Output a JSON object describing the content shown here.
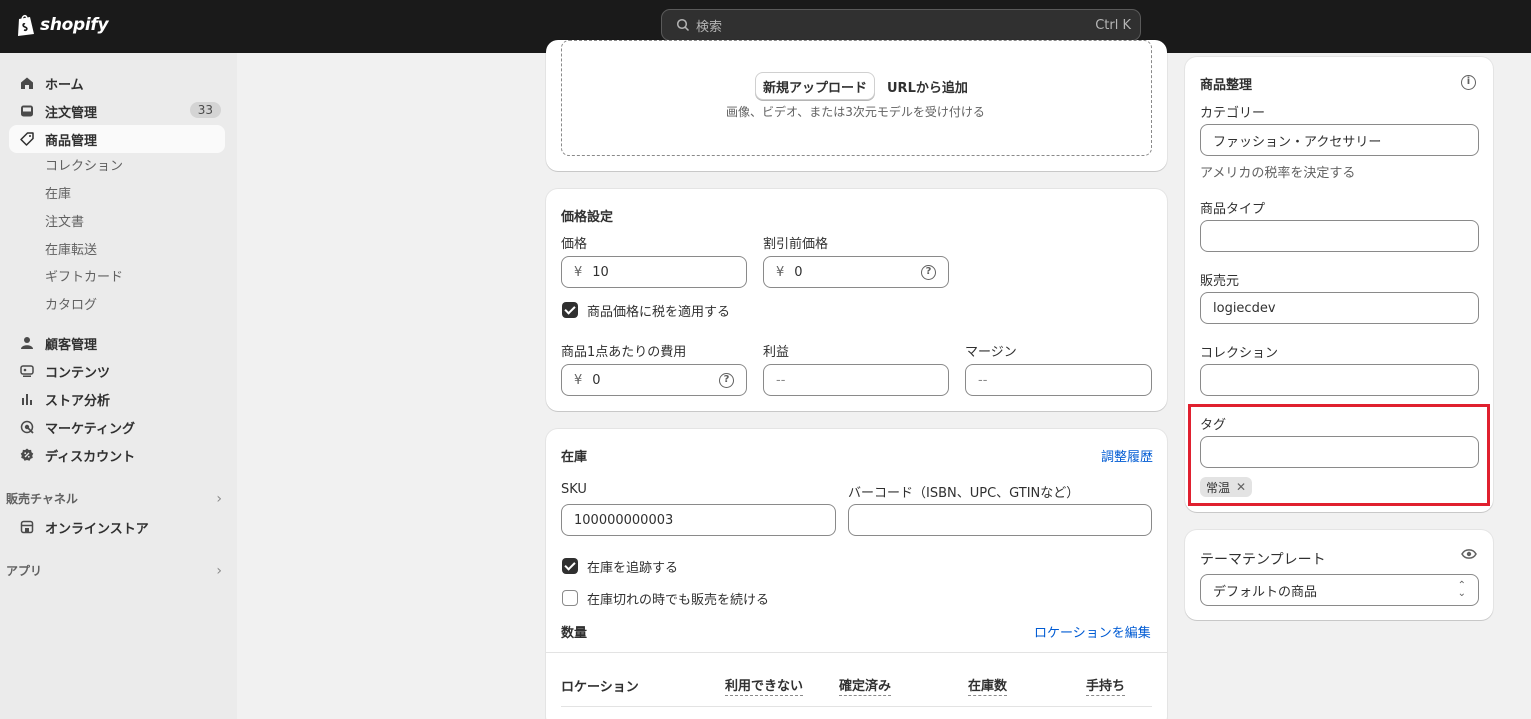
{
  "app": {
    "brand": "shopify"
  },
  "search": {
    "placeholder": "検索",
    "shortcut": "Ctrl K"
  },
  "sidebar": {
    "items": [
      {
        "label": "ホーム",
        "icon": "home-icon"
      },
      {
        "label": "注文管理",
        "icon": "inbox-icon",
        "badge": "33"
      },
      {
        "label": "商品管理",
        "icon": "tag-icon"
      }
    ],
    "product_sub": [
      "コレクション",
      "在庫",
      "注文書",
      "在庫転送",
      "ギフトカード",
      "カタログ"
    ],
    "items2": [
      {
        "label": "顧客管理",
        "icon": "person-icon"
      },
      {
        "label": "コンテンツ",
        "icon": "content-icon"
      },
      {
        "label": "ストア分析",
        "icon": "chart-icon"
      },
      {
        "label": "マーケティング",
        "icon": "target-icon"
      },
      {
        "label": "ディスカウント",
        "icon": "discount-icon"
      }
    ],
    "sales_channels": "販売チャネル",
    "online_store": "オンラインストア",
    "apps": "アプリ"
  },
  "media": {
    "upload_button": "新規アップロード",
    "add_from_url": "URLから追加",
    "hint": "画像、ビデオ、または3次元モデルを受け付ける"
  },
  "pricing": {
    "title": "価格設定",
    "price_label": "価格",
    "price_value": "10",
    "compare_label": "割引前価格",
    "compare_value": "0",
    "currency": "¥",
    "tax_label": "商品価格に税を適用する",
    "cost_label": "商品1点あたりの費用",
    "cost_value": "0",
    "profit_label": "利益",
    "profit_value": "--",
    "margin_label": "マージン",
    "margin_value": "--"
  },
  "inventory": {
    "title": "在庫",
    "history_link": "調整履歴",
    "sku_label": "SKU",
    "sku_value": "100000000003",
    "barcode_label": "バーコード（ISBN、UPC、GTINなど）",
    "barcode_value": "",
    "track_label": "在庫を追跡する",
    "continue_label": "在庫切れの時でも販売を続ける",
    "qty_title": "数量",
    "edit_locations": "ロケーションを編集",
    "columns": [
      "ロケーション",
      "利用できない",
      "確定済み",
      "在庫数",
      "手持ち"
    ]
  },
  "organization": {
    "title": "商品整理",
    "category_label": "カテゴリー",
    "category_value": "ファッション・アクセサリー",
    "category_hint": "アメリカの税率を決定する",
    "type_label": "商品タイプ",
    "type_value": "",
    "vendor_label": "販売元",
    "vendor_value": "logiecdev",
    "collection_label": "コレクション",
    "collection_value": "",
    "tags_label": "タグ",
    "tags_value": "",
    "tags": [
      "常温"
    ]
  },
  "theme": {
    "title": "テーマテンプレート",
    "value": "デフォルトの商品"
  }
}
